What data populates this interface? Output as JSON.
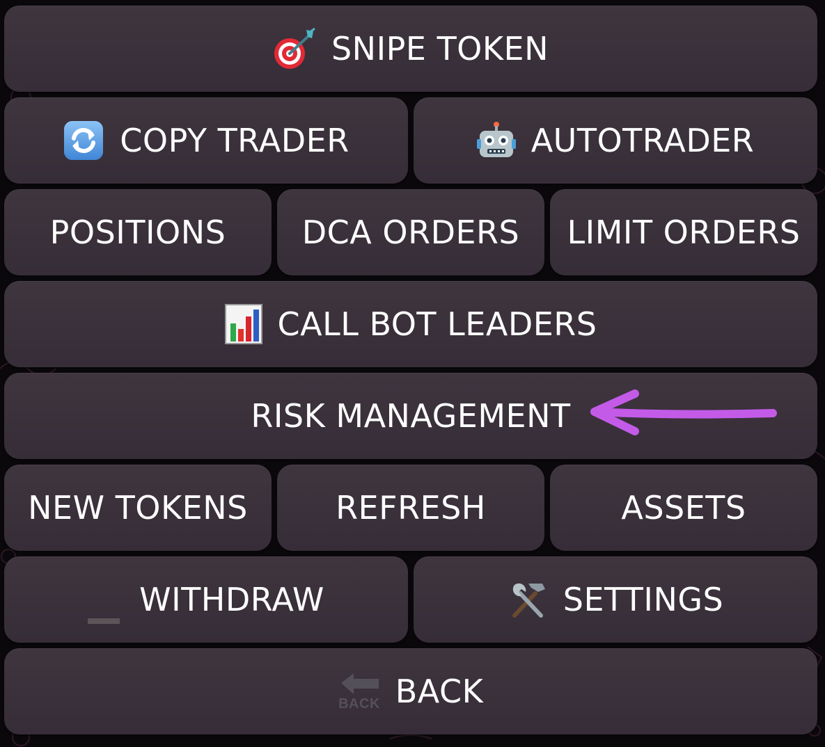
{
  "keyboard": {
    "snipe_token": "SNIPE TOKEN",
    "copy_trader": "COPY TRADER",
    "autotrader": "AUTOTRADER",
    "positions": "POSITIONS",
    "dca_orders": "DCA ORDERS",
    "limit_orders": "LIMIT ORDERS",
    "call_bot_leaders": "CALL BOT LEADERS",
    "risk_management": "RISK MANAGEMENT",
    "new_tokens": "NEW TOKENS",
    "refresh": "REFRESH",
    "assets": "ASSETS",
    "withdraw": "WITHDRAW",
    "settings": "SETTINGS",
    "back": "BACK",
    "back_icon_text": "BACK"
  },
  "icons": {
    "snipe_token": "direct-hit-target-icon",
    "copy_trader": "arrows-refresh-icon",
    "autotrader": "robot-icon",
    "call_bot_leaders": "bar-chart-icon",
    "withdraw": "minus-icon",
    "settings": "hammer-wrench-icon",
    "back": "back-arrow-icon"
  },
  "annotation": {
    "arrow_color": "#c35be8"
  },
  "colors": {
    "button_bg": "#3f3541",
    "background": "#0b080c",
    "text": "#ffffff"
  }
}
